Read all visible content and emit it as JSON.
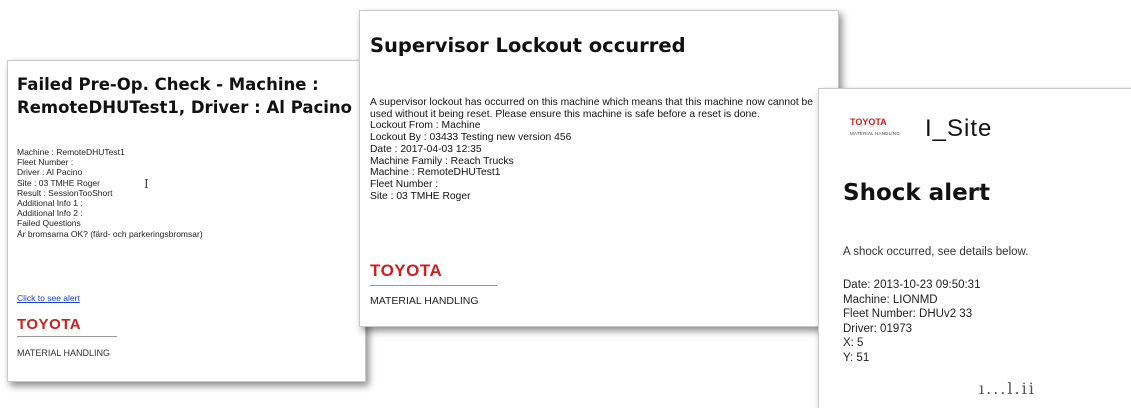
{
  "card1": {
    "title": "Failed Pre-Op. Check - Machine : RemoteDHUTest1, Driver : Al Pacino",
    "lines": [
      "Machine : RemoteDHUTest1",
      "Fleet Number :",
      "Driver : Al Pacino",
      "Site : 03 TMHE Roger",
      "Result : SessionTooShort",
      "Additional Info 1 :",
      "Additional Info 2 :",
      "Failed Questions",
      "Är bromsarna OK? (färd- och parkeringsbromsar)"
    ],
    "cursor": "I",
    "link": "Click to see alert",
    "brand": "TOYOTA",
    "brand_sub": "MATERIAL HANDLING"
  },
  "card2": {
    "title": "Supervisor Lockout occurred",
    "paragraph": "A supervisor lockout has occurred on this machine which means that this machine now cannot be used without it being reset. Please ensure this machine is safe before a reset is done.",
    "lines": [
      "Lockout From : Machine",
      "Lockout By : 03433 Testing new version 456",
      "Date : 2017-04-03 12:35",
      "Machine Family : Reach Trucks",
      "Machine : RemoteDHUTest1",
      "Fleet Number :",
      "Site : 03 TMHE Roger"
    ],
    "brand": "TOYOTA",
    "brand_sub": "MATERIAL HANDLING"
  },
  "card3": {
    "brand": "TOYOTA",
    "brand_sub": "MATERIAL HANDLING",
    "product": "I_Site",
    "title": "Shock alert",
    "intro": "A shock occurred, see details below.",
    "lines": [
      "Date: 2013-10-23 09:50:31",
      "Machine:  LIONMD",
      "Fleet Number: DHUv2 33",
      "Driver: 01973",
      "X: 5",
      "Y: 51"
    ],
    "peek": "ı...l.ii"
  }
}
